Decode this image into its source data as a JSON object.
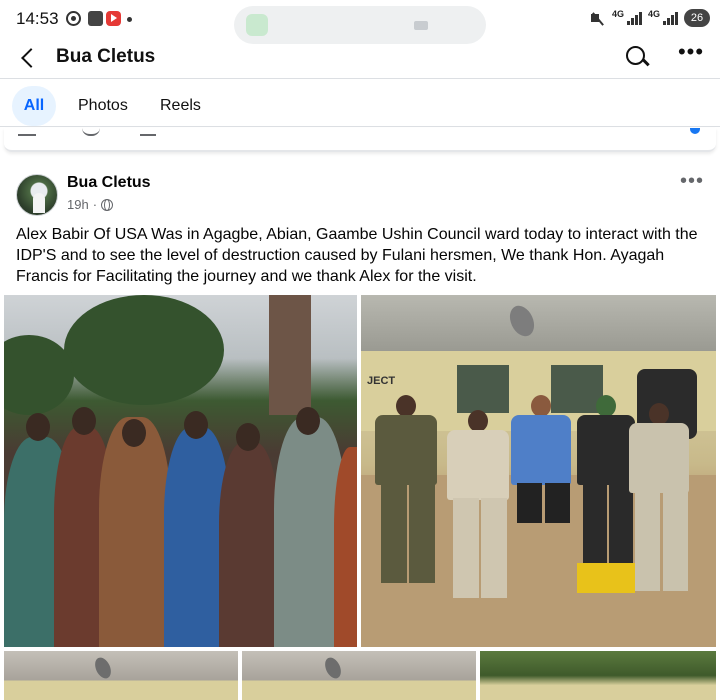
{
  "status_bar": {
    "time": "14:53",
    "network_1": "4G",
    "network_2": "4G",
    "battery": "26",
    "icons": [
      "whatsapp-icon",
      "document-icon",
      "youtube-icon",
      "mute-icon",
      "signal-icon",
      "battery-icon"
    ]
  },
  "header": {
    "title": "Bua Cletus",
    "back_icon": "chevron-left-icon",
    "search_icon": "search-icon",
    "more_label": "•••"
  },
  "tabs": [
    {
      "label": "All",
      "selected": true
    },
    {
      "label": "Photos",
      "selected": false
    },
    {
      "label": "Reels",
      "selected": false
    }
  ],
  "post": {
    "author": "Bua Cletus",
    "time": "19h",
    "separator": "·",
    "audience_icon": "globe-icon",
    "more_label": "•••",
    "text": "Alex Babir Of USA Was in Agagbe,  Abian, Gaambe Ushin Council ward today to interact with the IDP'S and to see the level of destruction caused by Fulani hersmen, We thank Hon. Ayagah Francis for Facilitating the journey and we thank Alex for the visit.",
    "photo_sign_text": "JECT"
  },
  "colors": {
    "accent": "#0866ff",
    "tab_selected_bg": "#e7f3ff",
    "secondary_text": "#65676b"
  }
}
